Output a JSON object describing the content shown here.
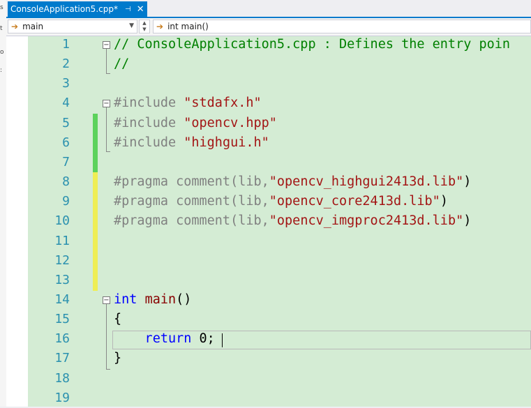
{
  "tab": {
    "title": "ConsoleApplication5.cpp*",
    "pin_glyph": "⊣",
    "close_glyph": "✕"
  },
  "navbar": {
    "scope_dropdown": {
      "icon": "arrow-right-icon",
      "value": "main"
    },
    "member_dropdown": {
      "icon": "arrow-right-icon",
      "value": "int main()"
    }
  },
  "colors": {
    "accent": "#007acc",
    "editor_bg": "#d4ecd4",
    "line_number": "#2b91af",
    "change_saved": "#5cd25c",
    "change_unsaved": "#eeee55"
  },
  "lines": [
    {
      "n": "1",
      "tokens": [
        {
          "t": "// ConsoleApplication5.cpp : Defines the entry poin",
          "c": "comment"
        }
      ]
    },
    {
      "n": "2",
      "tokens": [
        {
          "t": "//",
          "c": "comment"
        }
      ]
    },
    {
      "n": "3",
      "tokens": []
    },
    {
      "n": "4",
      "tokens": [
        {
          "t": "#include ",
          "c": "pp"
        },
        {
          "t": "\"stdafx.h\"",
          "c": "str"
        }
      ]
    },
    {
      "n": "5",
      "tokens": [
        {
          "t": "#include ",
          "c": "pp"
        },
        {
          "t": "\"opencv.hpp\"",
          "c": "str"
        }
      ]
    },
    {
      "n": "6",
      "tokens": [
        {
          "t": "#include ",
          "c": "pp"
        },
        {
          "t": "\"highgui.h\"",
          "c": "str"
        }
      ]
    },
    {
      "n": "7",
      "tokens": []
    },
    {
      "n": "8",
      "tokens": [
        {
          "t": "#pragma comment(lib,",
          "c": "pp"
        },
        {
          "t": "\"opencv_highgui2413d.lib\"",
          "c": "str"
        },
        {
          "t": ")",
          "c": "plain"
        }
      ]
    },
    {
      "n": "9",
      "tokens": [
        {
          "t": "#pragma comment(lib,",
          "c": "pp"
        },
        {
          "t": "\"opencv_core2413d.lib\"",
          "c": "str"
        },
        {
          "t": ")",
          "c": "plain"
        }
      ]
    },
    {
      "n": "10",
      "tokens": [
        {
          "t": "#pragma comment(lib,",
          "c": "pp"
        },
        {
          "t": "\"opencv_imgproc2413d.lib\"",
          "c": "str"
        },
        {
          "t": ")",
          "c": "plain"
        }
      ]
    },
    {
      "n": "11",
      "tokens": []
    },
    {
      "n": "12",
      "tokens": []
    },
    {
      "n": "13",
      "tokens": []
    },
    {
      "n": "14",
      "tokens": [
        {
          "t": "int ",
          "c": "kw"
        },
        {
          "t": "main",
          "c": "fn"
        },
        {
          "t": "()",
          "c": "plain"
        }
      ]
    },
    {
      "n": "15",
      "tokens": [
        {
          "t": "{",
          "c": "plain"
        }
      ]
    },
    {
      "n": "16",
      "tokens": [
        {
          "t": "    return ",
          "c": "kw"
        },
        {
          "t": "0;",
          "c": "plain"
        }
      ]
    },
    {
      "n": "17",
      "tokens": [
        {
          "t": "}",
          "c": "plain"
        }
      ]
    },
    {
      "n": "18",
      "tokens": []
    },
    {
      "n": "19",
      "tokens": []
    }
  ]
}
